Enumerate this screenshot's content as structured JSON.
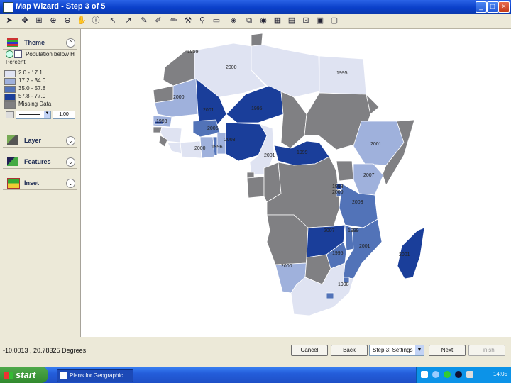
{
  "window": {
    "title": "Map Wizard - Step 3 of 5",
    "min": "_",
    "max": "□",
    "close": "×"
  },
  "toolbar": {
    "tools": [
      "pointer",
      "pan",
      "identify",
      "zoom-in",
      "zoom-out",
      "hand",
      "info",
      "select",
      "measure",
      "draw",
      "label",
      "text",
      "table",
      "buffer",
      "query",
      "globe",
      "layers",
      "settings",
      "print",
      "export"
    ]
  },
  "sidebar": {
    "sections": [
      {
        "id": "theme",
        "label": "Theme",
        "chev": "⌃"
      },
      {
        "id": "layer",
        "label": "Layer",
        "chev": "⌄"
      },
      {
        "id": "features",
        "label": "Features",
        "chev": "⌄"
      },
      {
        "id": "inset",
        "label": "Inset",
        "chev": "⌄"
      }
    ],
    "theme": {
      "field": "Population below H",
      "units": "Percent",
      "legend": [
        {
          "label": "2.0 - 17.1",
          "color": "#dfe3f2"
        },
        {
          "label": "17.2 - 34.0",
          "color": "#9fb1dc"
        },
        {
          "label": "35.0 - 57.8",
          "color": "#5273b8"
        },
        {
          "label": "57.8 - 77.0",
          "color": "#1a3e9a"
        },
        {
          "label": "Missing Data",
          "color": "#7f7f82"
        }
      ],
      "line_width": "1.00"
    }
  },
  "map": {
    "colors": {
      "c1": "#dfe3f2",
      "c2": "#9fb1dc",
      "c3": "#5273b8",
      "c4": "#1a3e9a",
      "missing": "#808083",
      "sea": "#ffffff"
    },
    "year_labels": [
      "1999",
      "2000",
      "1995",
      "2000",
      "1993",
      "2001",
      "2000",
      "1995",
      "2005",
      "1996",
      "2003",
      "2001",
      "1999",
      "2007",
      "2001",
      "1993",
      "2000",
      "2003",
      "2007",
      "1999",
      "2001",
      "1995",
      "2000",
      "1998",
      "2001"
    ]
  },
  "bottom": {
    "coords": "-10.0013 , 20.78325 Degrees",
    "buttons": {
      "cancel": "Cancel",
      "back": "Back",
      "next": "Next",
      "finish": "Finish"
    },
    "step_select": "Step 3: Settings"
  },
  "taskbar": {
    "start": "start",
    "item": "Plans for Geographic...",
    "clock": "14:05"
  }
}
